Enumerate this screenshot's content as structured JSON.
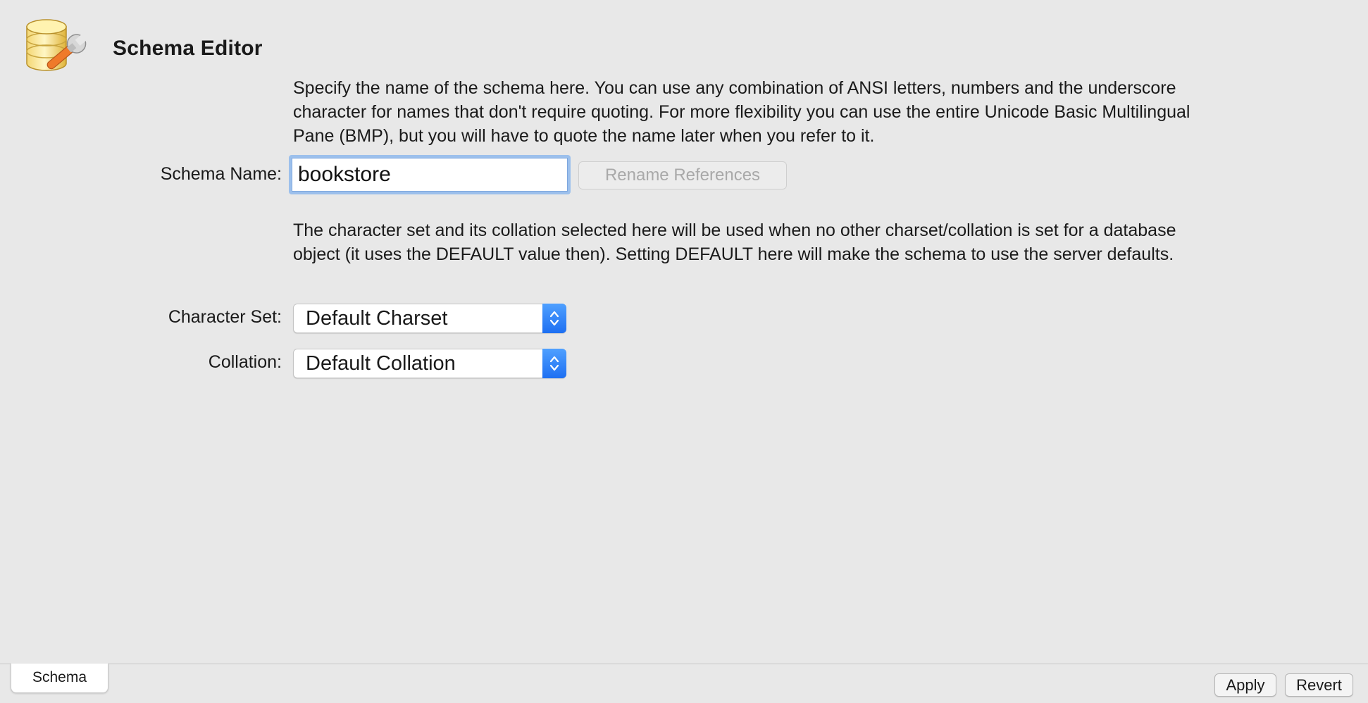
{
  "header": {
    "title": "Schema Editor",
    "icon": "database-wrench-icon"
  },
  "schema_section": {
    "description": "Specify the name of the schema here. You can use any combination of ANSI letters, numbers and the underscore character for names that don't require quoting. For more flexibility you can use the entire Unicode Basic Multilingual Pane (BMP), but you will have to quote the name later when you refer to it.",
    "name_label": "Schema Name:",
    "name_value": "bookstore",
    "rename_button_label": "Rename References"
  },
  "charset_section": {
    "description": "The character set and its collation selected here will be used when no other charset/collation is set for a database object (it uses the DEFAULT value then). Setting DEFAULT here will make the schema to use the server defaults.",
    "charset_label": "Character Set:",
    "charset_value": "Default Charset",
    "collation_label": "Collation:",
    "collation_value": "Default Collation"
  },
  "bottom_bar": {
    "tab_label": "Schema",
    "apply_label": "Apply",
    "revert_label": "Revert"
  },
  "colors": {
    "background": "#e8e8e8",
    "focus_ring": "#9cc0ec",
    "select_accent": "#2b7cf6"
  }
}
